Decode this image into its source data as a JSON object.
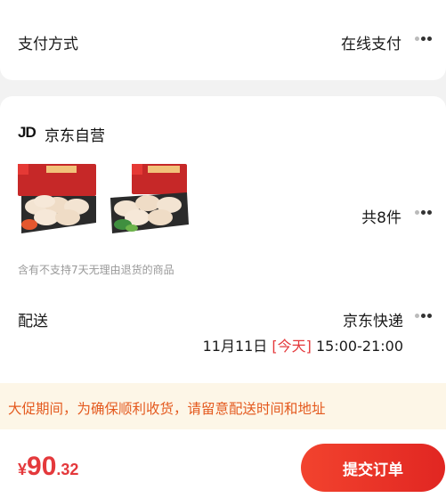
{
  "payment": {
    "label": "支付方式",
    "value": "在线支付"
  },
  "shop": {
    "logo_text": "JD",
    "name": "京东自营"
  },
  "items": {
    "count_text": "共8件"
  },
  "return_notice": "含有不支持7天无理由退货的商品",
  "delivery": {
    "label": "配送",
    "method": "京东快递",
    "date": "11月11日",
    "today_tag": "[今天]",
    "time": "15:00-21:00"
  },
  "banner_text": "大促期间，为确保顺利收货，请留意配送时间和地址",
  "footer": {
    "currency": "¥",
    "price_int": "90",
    "price_dec": ".32",
    "submit_label": "提交订单"
  },
  "colors": {
    "accent": "#e4393c",
    "banner_bg": "#fdf6e7",
    "banner_text": "#e45a1f",
    "notice_text": "#999999"
  },
  "icons": [
    "more-dots-icon",
    "jd-logo",
    "dumpling-product-image"
  ]
}
